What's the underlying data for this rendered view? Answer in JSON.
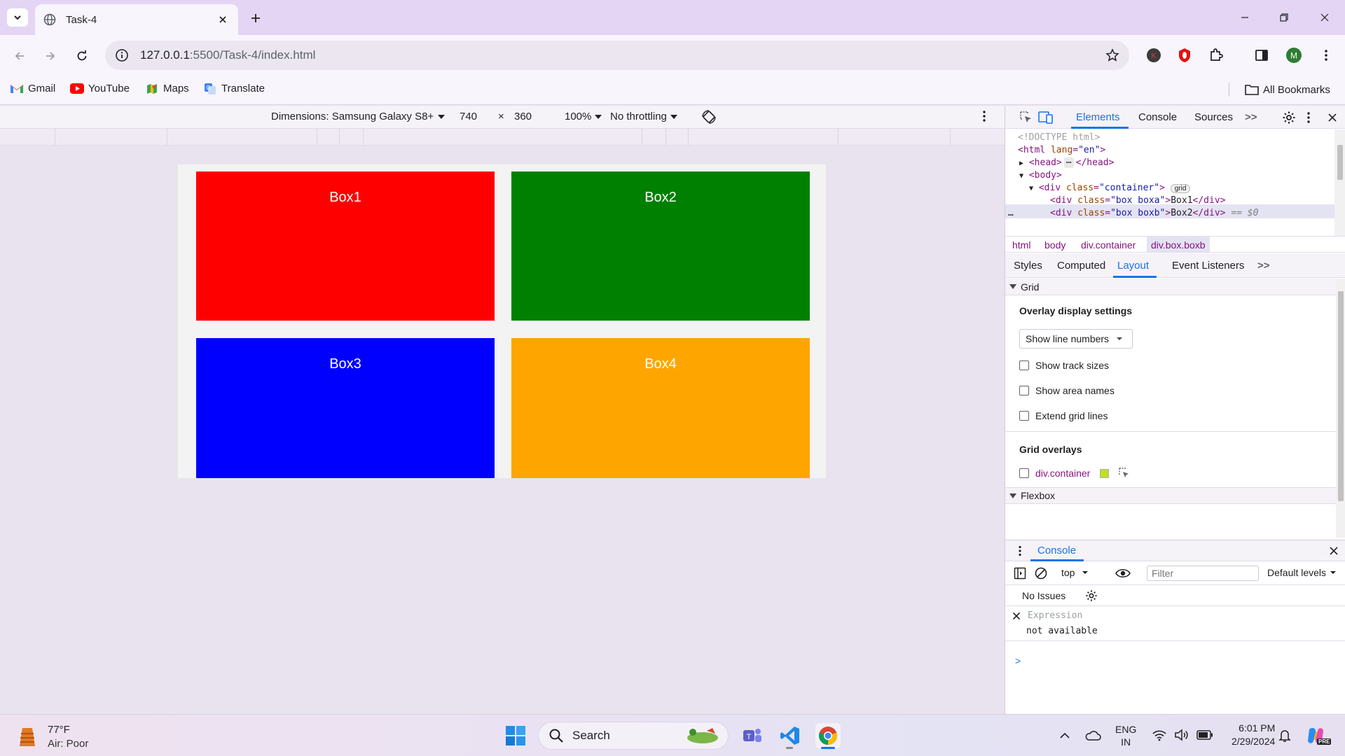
{
  "browser": {
    "tab_title": "Task-4",
    "url_host": "127.0.0.1",
    "url_rest": ":5500/Task-4/index.html",
    "profile_letter_k": "K",
    "profile_letter_m": "M"
  },
  "bookmarks": {
    "items": [
      {
        "label": "Gmail",
        "icon": "gmail-icon"
      },
      {
        "label": "YouTube",
        "icon": "youtube-icon"
      },
      {
        "label": "Maps",
        "icon": "maps-icon"
      },
      {
        "label": "Translate",
        "icon": "translate-icon"
      }
    ],
    "all_bookmarks": "All Bookmarks"
  },
  "device_toolbar": {
    "dimensions": "Dimensions: Samsung Galaxy S8+",
    "width": "740",
    "times": "×",
    "height": "360",
    "zoom": "100%",
    "throttling": "No throttling"
  },
  "page": {
    "boxes": [
      {
        "label": "Box1",
        "color": "#ff0000"
      },
      {
        "label": "Box2",
        "color": "#008000"
      },
      {
        "label": "Box3",
        "color": "#0000ff"
      },
      {
        "label": "Box4",
        "color": "#ffa500"
      }
    ]
  },
  "devtools": {
    "tabs": {
      "elements": "Elements",
      "console": "Console",
      "sources": "Sources",
      "more": ">>"
    },
    "dom": {
      "doctype": "<!DOCTYPE html>",
      "html_open_tag": "<html",
      "html_attr": "lang",
      "html_val": "\"en\"",
      "head": "<head>",
      "head_close": "</head>",
      "ellipsis": "⋯",
      "body": "<body>",
      "div_open": "<div",
      "class_attr": "class",
      "container_val": "\"container\"",
      "grid_badge": "grid",
      "boxa_val": "\"box boxa\"",
      "boxa_text": "Box1",
      "boxb_val": "\"box boxb\"",
      "boxb_text": "Box2",
      "div_close": "</div>",
      "eq_s0": "== $0",
      "more_dots": "…"
    },
    "breadcrumbs": [
      "html",
      "body",
      "div.container",
      "div.box.boxb"
    ],
    "subtabs": {
      "styles": "Styles",
      "computed": "Computed",
      "layout": "Layout",
      "event_listeners": "Event Listeners",
      "more": ">>"
    },
    "layout": {
      "grid_heading": "Grid",
      "overlay_heading": "Overlay display settings",
      "line_numbers_select": "Show line numbers",
      "checks": [
        "Show track sizes",
        "Show area names",
        "Extend grid lines"
      ],
      "grid_overlays_heading": "Grid overlays",
      "overlay_item": "div.container",
      "overlay_color": "#c0e020",
      "flexbox_heading": "Flexbox"
    },
    "console": {
      "tab": "Console",
      "context": "top",
      "filter_placeholder": "Filter",
      "levels": "Default levels",
      "issues": "No Issues",
      "expression_placeholder": "Expression",
      "expression_value": "not available",
      "prompt": ">"
    }
  },
  "taskbar": {
    "weather_temp": "77°F",
    "weather_desc": "Air: Poor",
    "search_label": "Search",
    "lang_line1": "ENG",
    "lang_line2": "IN",
    "time": "6:01 PM",
    "date": "2/29/2024"
  }
}
